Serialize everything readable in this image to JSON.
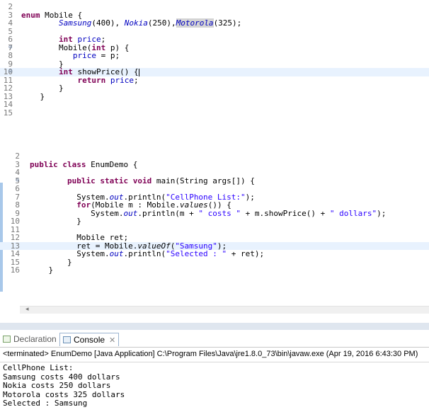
{
  "editor1": {
    "lines": [
      {
        "n": "2",
        "fold": "",
        "spans": [],
        "hl": false
      },
      {
        "n": "3",
        "fold": "",
        "spans": [
          {
            "t": "enum ",
            "c": "kw"
          },
          {
            "t": "Mobile {",
            "c": ""
          }
        ],
        "hl": false
      },
      {
        "n": "4",
        "fold": "",
        "spans": [
          {
            "t": "        ",
            "c": ""
          },
          {
            "t": "Samsung",
            "c": "ital-fld"
          },
          {
            "t": "(400), ",
            "c": ""
          },
          {
            "t": "Nokia",
            "c": "ital-fld"
          },
          {
            "t": "(250),",
            "c": ""
          },
          {
            "t": "Motorola",
            "c": "ital-fld sel-word"
          },
          {
            "t": "(325);",
            "c": ""
          }
        ],
        "hl": false
      },
      {
        "n": "5",
        "fold": "",
        "spans": [],
        "hl": false
      },
      {
        "n": "6",
        "fold": "",
        "spans": [
          {
            "t": "        ",
            "c": ""
          },
          {
            "t": "int ",
            "c": "kw"
          },
          {
            "t": "price",
            "c": "fld"
          },
          {
            "t": ";",
            "c": ""
          }
        ],
        "hl": false
      },
      {
        "n": "7",
        "fold": "⊖",
        "spans": [
          {
            "t": "        Mobile(",
            "c": ""
          },
          {
            "t": "int ",
            "c": "kw"
          },
          {
            "t": "p) {",
            "c": ""
          }
        ],
        "hl": false
      },
      {
        "n": "8",
        "fold": "",
        "spans": [
          {
            "t": "           ",
            "c": ""
          },
          {
            "t": "price",
            "c": "fld"
          },
          {
            "t": " = p;",
            "c": ""
          }
        ],
        "hl": false
      },
      {
        "n": "9",
        "fold": "",
        "spans": [
          {
            "t": "        }",
            "c": ""
          }
        ],
        "hl": false
      },
      {
        "n": "10",
        "fold": "⊖",
        "spans": [
          {
            "t": "        ",
            "c": ""
          },
          {
            "t": "int ",
            "c": "kw"
          },
          {
            "t": "showPrice() {",
            "c": ""
          }
        ],
        "hl": true,
        "cursor": true
      },
      {
        "n": "11",
        "fold": "",
        "spans": [
          {
            "t": "            ",
            "c": ""
          },
          {
            "t": "return ",
            "c": "kw"
          },
          {
            "t": "price",
            "c": "fld"
          },
          {
            "t": ";",
            "c": ""
          }
        ],
        "hl": false
      },
      {
        "n": "12",
        "fold": "",
        "spans": [
          {
            "t": "        }",
            "c": ""
          }
        ],
        "hl": false
      },
      {
        "n": "13",
        "fold": "",
        "spans": [
          {
            "t": "    }",
            "c": ""
          }
        ],
        "hl": false
      },
      {
        "n": "14",
        "fold": "",
        "spans": [],
        "hl": false
      },
      {
        "n": "15",
        "fold": "",
        "spans": [],
        "hl": false
      }
    ]
  },
  "editor2": {
    "lines": [
      {
        "n": "2",
        "fold": "",
        "spans": [],
        "hl": false
      },
      {
        "n": "3",
        "fold": "",
        "spans": [
          {
            "t": "public ",
            "c": "kw"
          },
          {
            "t": "class ",
            "c": "kw"
          },
          {
            "t": "EnumDemo {",
            "c": ""
          }
        ],
        "hl": false
      },
      {
        "n": "4",
        "fold": "",
        "spans": [],
        "hl": false
      },
      {
        "n": "5",
        "fold": "⊖",
        "spans": [
          {
            "t": "        ",
            "c": ""
          },
          {
            "t": "public ",
            "c": "kw"
          },
          {
            "t": "static ",
            "c": "kw"
          },
          {
            "t": "void ",
            "c": "kw"
          },
          {
            "t": "main(String args[]) {",
            "c": ""
          }
        ],
        "hl": false
      },
      {
        "n": "6",
        "fold": "",
        "spans": [],
        "hl": false
      },
      {
        "n": "7",
        "fold": "",
        "spans": [
          {
            "t": "          System.",
            "c": ""
          },
          {
            "t": "out",
            "c": "ital-fld"
          },
          {
            "t": ".println(",
            "c": ""
          },
          {
            "t": "\"CellPhone List:\"",
            "c": "str"
          },
          {
            "t": ");",
            "c": ""
          }
        ],
        "hl": false
      },
      {
        "n": "8",
        "fold": "",
        "spans": [
          {
            "t": "          ",
            "c": ""
          },
          {
            "t": "for",
            "c": "kw"
          },
          {
            "t": "(Mobile m : Mobile.",
            "c": ""
          },
          {
            "t": "values",
            "c": "ital"
          },
          {
            "t": "()) {",
            "c": ""
          }
        ],
        "hl": false
      },
      {
        "n": "9",
        "fold": "",
        "spans": [
          {
            "t": "             System.",
            "c": ""
          },
          {
            "t": "out",
            "c": "ital-fld"
          },
          {
            "t": ".println(m + ",
            "c": ""
          },
          {
            "t": "\" costs \"",
            "c": "str"
          },
          {
            "t": " + m.showPrice() + ",
            "c": ""
          },
          {
            "t": "\" dollars\"",
            "c": "str"
          },
          {
            "t": ");",
            "c": ""
          }
        ],
        "hl": false
      },
      {
        "n": "10",
        "fold": "",
        "spans": [
          {
            "t": "          }",
            "c": ""
          }
        ],
        "hl": false
      },
      {
        "n": "11",
        "fold": "",
        "spans": [],
        "hl": false
      },
      {
        "n": "12",
        "fold": "",
        "spans": [
          {
            "t": "          Mobile ret;",
            "c": ""
          }
        ],
        "hl": false
      },
      {
        "n": "13",
        "fold": "",
        "spans": [
          {
            "t": "          ret = Mobile.",
            "c": ""
          },
          {
            "t": "valueOf",
            "c": "ital"
          },
          {
            "t": "(",
            "c": ""
          },
          {
            "t": "\"Samsung\"",
            "c": "str"
          },
          {
            "t": ");",
            "c": ""
          }
        ],
        "hl": true
      },
      {
        "n": "14",
        "fold": "",
        "spans": [
          {
            "t": "          System.",
            "c": ""
          },
          {
            "t": "out",
            "c": "ital-fld"
          },
          {
            "t": ".println(",
            "c": ""
          },
          {
            "t": "\"Selected : \"",
            "c": "str"
          },
          {
            "t": " + ret);",
            "c": ""
          }
        ],
        "hl": false
      },
      {
        "n": "15",
        "fold": "",
        "spans": [
          {
            "t": "        }",
            "c": ""
          }
        ],
        "hl": false
      },
      {
        "n": "16",
        "fold": "",
        "spans": [
          {
            "t": "    }",
            "c": ""
          }
        ],
        "hl": false
      }
    ]
  },
  "scroll": {
    "left_arrow": "◂"
  },
  "tabs": {
    "declaration": "Declaration",
    "console": "Console",
    "close": "✕"
  },
  "console": {
    "terminated": "<terminated> EnumDemo [Java Application] C:\\Program Files\\Java\\jre1.8.0_73\\bin\\javaw.exe (Apr 19, 2016 6:43:30 PM)",
    "output": [
      "CellPhone List:",
      "Samsung costs 400 dollars",
      "Nokia costs 250 dollars",
      "Motorola costs 325 dollars",
      "Selected : Samsung"
    ]
  },
  "colors": {
    "keyword": "#7f0055",
    "field": "#0000c0",
    "string": "#2a00ff",
    "current_line": "#e8f2fe"
  }
}
